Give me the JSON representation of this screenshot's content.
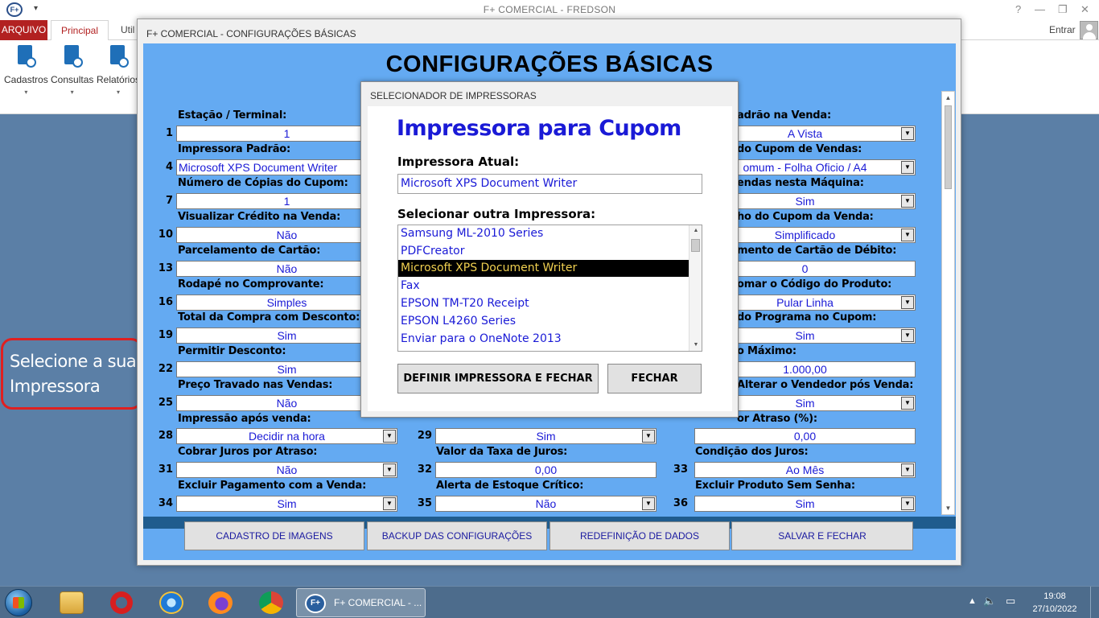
{
  "app": {
    "title": "F+ COMERCIAL - FREDSON",
    "logo_text": "F+",
    "help": "?",
    "minimize": "—",
    "restore": "❐",
    "close": "✕"
  },
  "ribbon": {
    "tabs": {
      "arquivo": "ARQUIVO",
      "principal": "Principal",
      "util": "Util"
    },
    "entrar": "Entrar",
    "buttons": [
      {
        "label": "Cadastros",
        "icon": "document-add-icon"
      },
      {
        "label": "Consultas",
        "icon": "document-search-icon"
      },
      {
        "label": "Relatórios",
        "icon": "report-clock-icon"
      }
    ]
  },
  "callout": {
    "line1": "Selecione a sua",
    "line2": "Impressora"
  },
  "config": {
    "window_title": "F+ COMERCIAL - CONFIGURAÇÕES BÁSICAS",
    "heading": "CONFIGURAÇÕES BÁSICAS",
    "col1": [
      {
        "num": "1",
        "label": "Estação / Terminal:",
        "value": "1"
      },
      {
        "num": "4",
        "label": "Impressora Padrão:",
        "value": "Microsoft XPS Document Writer"
      },
      {
        "num": "7",
        "label": "Número de Cópias do Cupom:",
        "value": "1"
      },
      {
        "num": "10",
        "label": "Visualizar Crédito na Venda:",
        "value": "Não"
      },
      {
        "num": "13",
        "label": "Parcelamento de Cartão:",
        "value": "Não"
      },
      {
        "num": "16",
        "label": "Rodapé no Comprovante:",
        "value": "Simples"
      },
      {
        "num": "19",
        "label": "Total da Compra com Desconto:",
        "value": "Sim"
      },
      {
        "num": "22",
        "label": "Permitir Desconto:",
        "value": "Sim"
      },
      {
        "num": "25",
        "label": "Preço Travado nas Vendas:",
        "value": "Não"
      },
      {
        "num": "28",
        "label": "Impressão após venda:",
        "value": "Decidir na hora"
      },
      {
        "num": "31",
        "label": "Cobrar Juros por Atraso:",
        "value": "Não"
      },
      {
        "num": "34",
        "label": "Excluir Pagamento com a Venda:",
        "value": "Sim"
      }
    ],
    "col2_partial": {
      "num29": "29",
      "value29": "Sim"
    },
    "col2": [
      {
        "num": "32",
        "label": "Valor da Taxa de Juros:",
        "value": "0,00"
      },
      {
        "num": "35",
        "label": "Alerta de Estoque Crítico:",
        "value": "Não"
      }
    ],
    "col3": [
      {
        "label": "adrão na Venda:",
        "value": "A Vista"
      },
      {
        "label": "do Cupom de Vendas:",
        "value": "omum - Folha Oficio / A4"
      },
      {
        "label": "endas nesta Máquina:",
        "value": "Sim"
      },
      {
        "label": "ho do Cupom da Venda:",
        "value": "Simplificado"
      },
      {
        "label": "mento de Cartão de Débito:",
        "value": "0"
      },
      {
        "label": "omar o Código do Produto:",
        "value": "Pular Linha"
      },
      {
        "label": "do Programa no Cupom:",
        "value": "Sim"
      },
      {
        "label": "o Máximo:",
        "value": "1.000,00"
      },
      {
        "label": "Alterar o Vendedor pós Venda:",
        "value": "Sim"
      },
      {
        "label": "or Atraso (%):",
        "value": "0,00"
      },
      {
        "num": "33",
        "label": "Condição dos Juros:",
        "value": "Ao Mês"
      },
      {
        "num": "36",
        "label": "Excluir Produto Sem Senha:",
        "value": "Sim"
      }
    ],
    "buttons": {
      "imagens": "CADASTRO DE IMAGENS",
      "backup": "BACKUP DAS CONFIGURAÇÕES",
      "redefinicao": "REDEFINIÇÃO DE DADOS",
      "salvar": "SALVAR E FECHAR"
    }
  },
  "printer_selector": {
    "window_title": "SELECIONADOR DE IMPRESSORAS",
    "heading": "Impressora para Cupom",
    "current_label": "Impressora Atual:",
    "current_value": "Microsoft XPS Document Writer",
    "list_label": "Selecionar outra Impressora:",
    "printers": [
      "Samsung ML-2010 Series",
      "PDFCreator",
      "Microsoft XPS Document Writer",
      "Fax",
      "EPSON TM-T20 Receipt",
      "EPSON L4260 Series",
      "Enviar para o OneNote 2013"
    ],
    "selected_index": 2,
    "btn_define": "DEFINIR IMPRESSORA E FECHAR",
    "btn_close": "FECHAR"
  },
  "taskbar": {
    "app_label": "F+ COMERCIAL - ...",
    "app_logo": "F+",
    "tray_arrow": "▲",
    "time": "19:08",
    "date": "27/10/2022"
  },
  "colors": {
    "panel_blue": "#64aaf2",
    "value_blue": "#1a1ad6",
    "ribbon_red": "#b22121",
    "selected_bg": "#000000",
    "selected_fg": "#f0d050",
    "callout_border": "#e02020"
  }
}
